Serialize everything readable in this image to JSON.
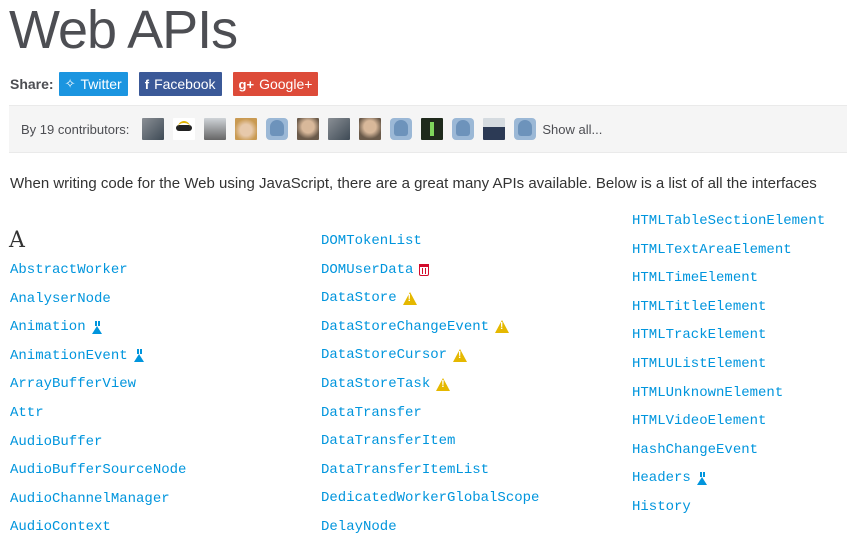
{
  "page": {
    "title": "Web APIs",
    "intro": "When writing code for the Web using JavaScript, there are a great many APIs available. Below is a list of all the interfaces"
  },
  "share": {
    "label": "Share:",
    "twitter": "Twitter",
    "facebook": "Facebook",
    "google": "Google+"
  },
  "contributors": {
    "label": "By 19 contributors:",
    "show_all": "Show all..."
  },
  "letter": "A",
  "columns": [
    {
      "items": [
        {
          "name": "AbstractWorker",
          "badge": ""
        },
        {
          "name": "AnalyserNode",
          "badge": ""
        },
        {
          "name": "Animation",
          "badge": "experimental"
        },
        {
          "name": "AnimationEvent",
          "badge": "experimental"
        },
        {
          "name": "ArrayBufferView",
          "badge": ""
        },
        {
          "name": "Attr",
          "badge": ""
        },
        {
          "name": "AudioBuffer",
          "badge": ""
        },
        {
          "name": "AudioBufferSourceNode",
          "badge": ""
        },
        {
          "name": "AudioChannelManager",
          "badge": ""
        },
        {
          "name": "AudioContext",
          "badge": ""
        }
      ]
    },
    {
      "items": [
        {
          "name": "DOMTokenList",
          "badge": ""
        },
        {
          "name": "DOMUserData",
          "badge": "deprecated"
        },
        {
          "name": "DataStore",
          "badge": "warning"
        },
        {
          "name": "DataStoreChangeEvent",
          "badge": "warning"
        },
        {
          "name": "DataStoreCursor",
          "badge": "warning"
        },
        {
          "name": "DataStoreTask",
          "badge": "warning"
        },
        {
          "name": "DataTransfer",
          "badge": ""
        },
        {
          "name": "DataTransferItem",
          "badge": ""
        },
        {
          "name": "DataTransferItemList",
          "badge": ""
        },
        {
          "name": "DedicatedWorkerGlobalScope",
          "badge": ""
        },
        {
          "name": "DelayNode",
          "badge": ""
        }
      ]
    },
    {
      "items": [
        {
          "name": "HTMLTableSectionElement",
          "badge": ""
        },
        {
          "name": "HTMLTextAreaElement",
          "badge": ""
        },
        {
          "name": "HTMLTimeElement",
          "badge": ""
        },
        {
          "name": "HTMLTitleElement",
          "badge": ""
        },
        {
          "name": "HTMLTrackElement",
          "badge": ""
        },
        {
          "name": "HTMLUListElement",
          "badge": ""
        },
        {
          "name": "HTMLUnknownElement",
          "badge": ""
        },
        {
          "name": "HTMLVideoElement",
          "badge": ""
        },
        {
          "name": "HashChangeEvent",
          "badge": ""
        },
        {
          "name": "Headers",
          "badge": "experimental"
        },
        {
          "name": "History",
          "badge": ""
        }
      ]
    }
  ],
  "avatars": [
    {
      "icon": "contributor-avatar-photo"
    },
    {
      "icon": "contributor-avatar-logo"
    },
    {
      "icon": "contributor-avatar-mono"
    },
    {
      "icon": "contributor-avatar-blonde"
    },
    {
      "icon": "contributor-avatar-default"
    },
    {
      "icon": "contributor-avatar-face"
    },
    {
      "icon": "contributor-avatar-photo"
    },
    {
      "icon": "contributor-avatar-face"
    },
    {
      "icon": "contributor-avatar-default"
    },
    {
      "icon": "contributor-avatar-dark"
    },
    {
      "icon": "contributor-avatar-default"
    },
    {
      "icon": "contributor-avatar-suit"
    },
    {
      "icon": "contributor-avatar-default"
    }
  ]
}
